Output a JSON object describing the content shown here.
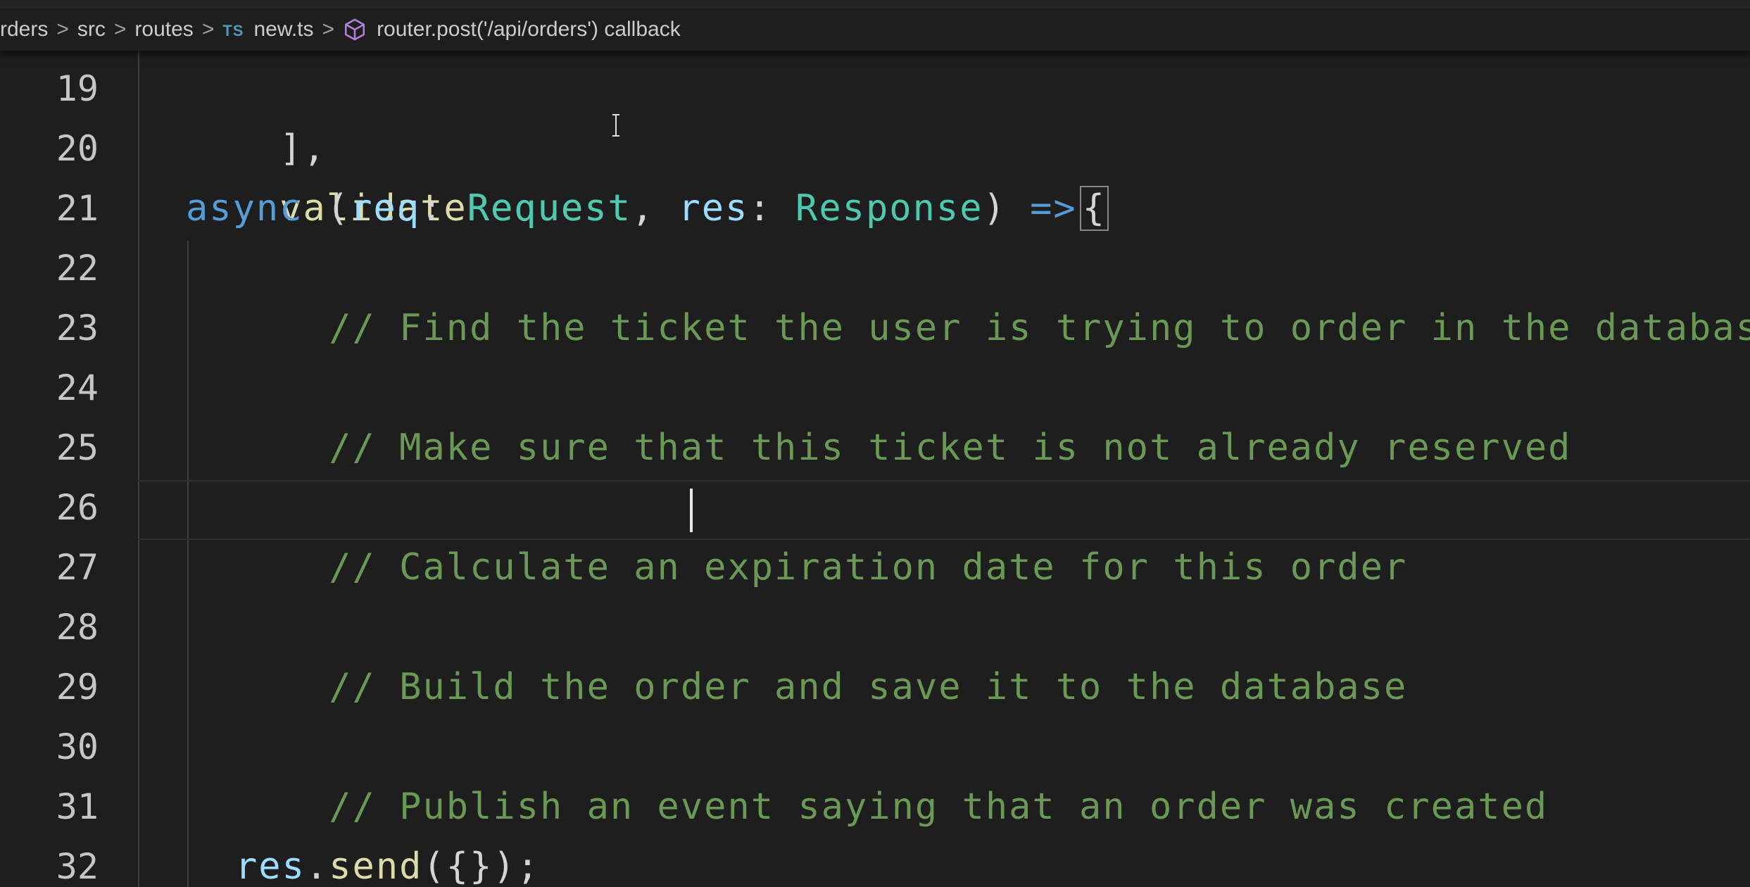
{
  "breadcrumb": {
    "items": [
      "rders",
      "src",
      "routes"
    ],
    "file_badge": "TS",
    "file_name": "new.ts",
    "symbol": "router.post('/api/orders') callback",
    "separator": ">"
  },
  "editor": {
    "line_numbers": [
      "19",
      "20",
      "21",
      "22",
      "23",
      "24",
      "25",
      "26",
      "27",
      "28",
      "29",
      "30",
      "31",
      "32"
    ],
    "lines": {
      "l19": "],",
      "l20": "validateRequest,",
      "l21_async": "async",
      "l21_open": " (",
      "l21_req": "req",
      "l21_colon1": ": ",
      "l21_reqtype": "Request",
      "l21_comma": ", ",
      "l21_res": "res",
      "l21_colon2": ": ",
      "l21_restype": "Response",
      "l21_close": ") ",
      "l21_arrow": "=>",
      "l21_brace": "{",
      "l22": "// Find the ticket the user is trying to order in the database",
      "l24": "// Make sure that this ticket is not already reserved",
      "l26": "// Calculate an expiration date for this order",
      "l28": "// Build the order and save it to the database",
      "l30": "// Publish an event saying that an order was created",
      "l32_obj": "res",
      "l32_dot": ".",
      "l32_fn": "send",
      "l32_rest": "({});"
    }
  },
  "colors": {
    "background": "#1e1e1e",
    "comment": "#6a9955",
    "keyword": "#569cd6",
    "variable": "#9cdcfe",
    "type": "#4ec9b0",
    "function": "#dcdcaa"
  },
  "icons": {
    "breadcrumb_symbol": "cube-icon",
    "mouse_pointer": "ibeam-cursor-icon"
  }
}
